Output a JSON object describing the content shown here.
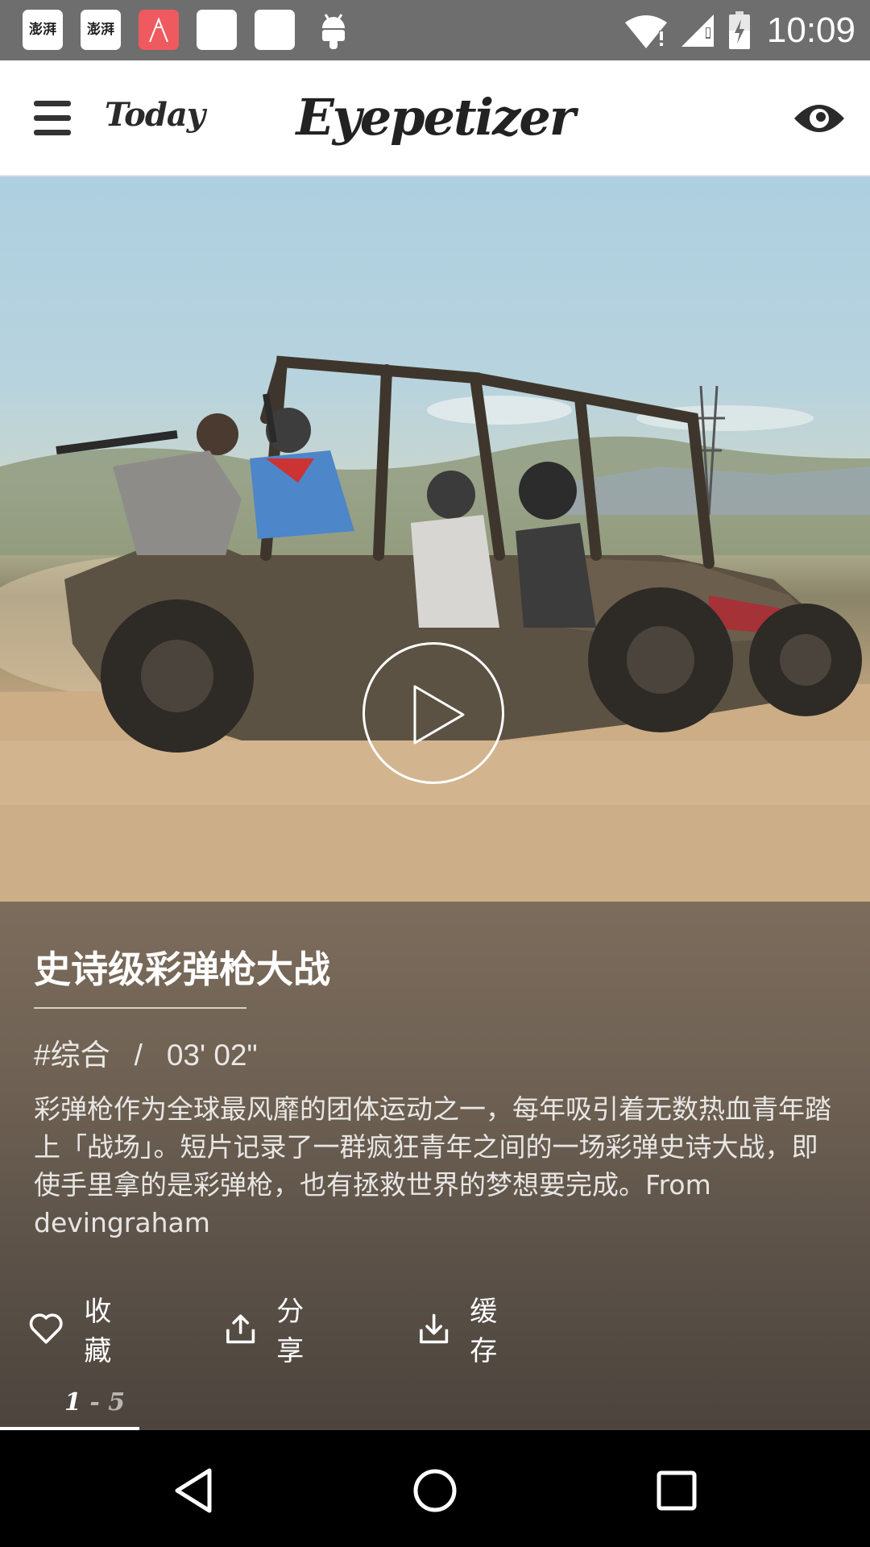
{
  "status_bar": {
    "time": "10:09",
    "notification_icons": [
      "news-app-icon",
      "news-app-icon",
      "red-app-icon",
      "white-app-icon",
      "white-app-icon",
      "android-icon"
    ],
    "news_icon_text": "澎湃",
    "system_icons": [
      "wifi-icon",
      "signal-icon",
      "battery-charging-icon"
    ]
  },
  "toolbar": {
    "menu_icon": "hamburger-menu-icon",
    "section_label": "Today",
    "brand": "Eyepetizer",
    "eye_icon": "eye-icon"
  },
  "video": {
    "title": "史诗级彩弹枪大战",
    "category": "#综合",
    "separator": "/",
    "duration": "03' 02\"",
    "description": "彩弹枪作为全球最风靡的团体运动之一，每年吸引着无数热血青年踏上「战场」。短片记录了一群疯狂青年之间的一场彩弹史诗大战，即使手里拿的是彩弹枪，也有拯救世界的梦想要完成。From devingraham",
    "play_icon": "play-icon"
  },
  "actions": [
    {
      "icon": "heart-icon",
      "label": "收藏"
    },
    {
      "icon": "share-icon",
      "label": "分享"
    },
    {
      "icon": "download-icon",
      "label": "缓存"
    }
  ],
  "pager": {
    "current": "1",
    "dash": "-",
    "total": "5",
    "progress_fraction": 0.2
  },
  "nav_bar": [
    "back-icon",
    "home-icon",
    "recents-icon"
  ],
  "colors": {
    "status_bar": "#6e6e6e",
    "toolbar_bg": "#ffffff",
    "info_panel": "#6e6153",
    "nav_bar": "#000000"
  }
}
